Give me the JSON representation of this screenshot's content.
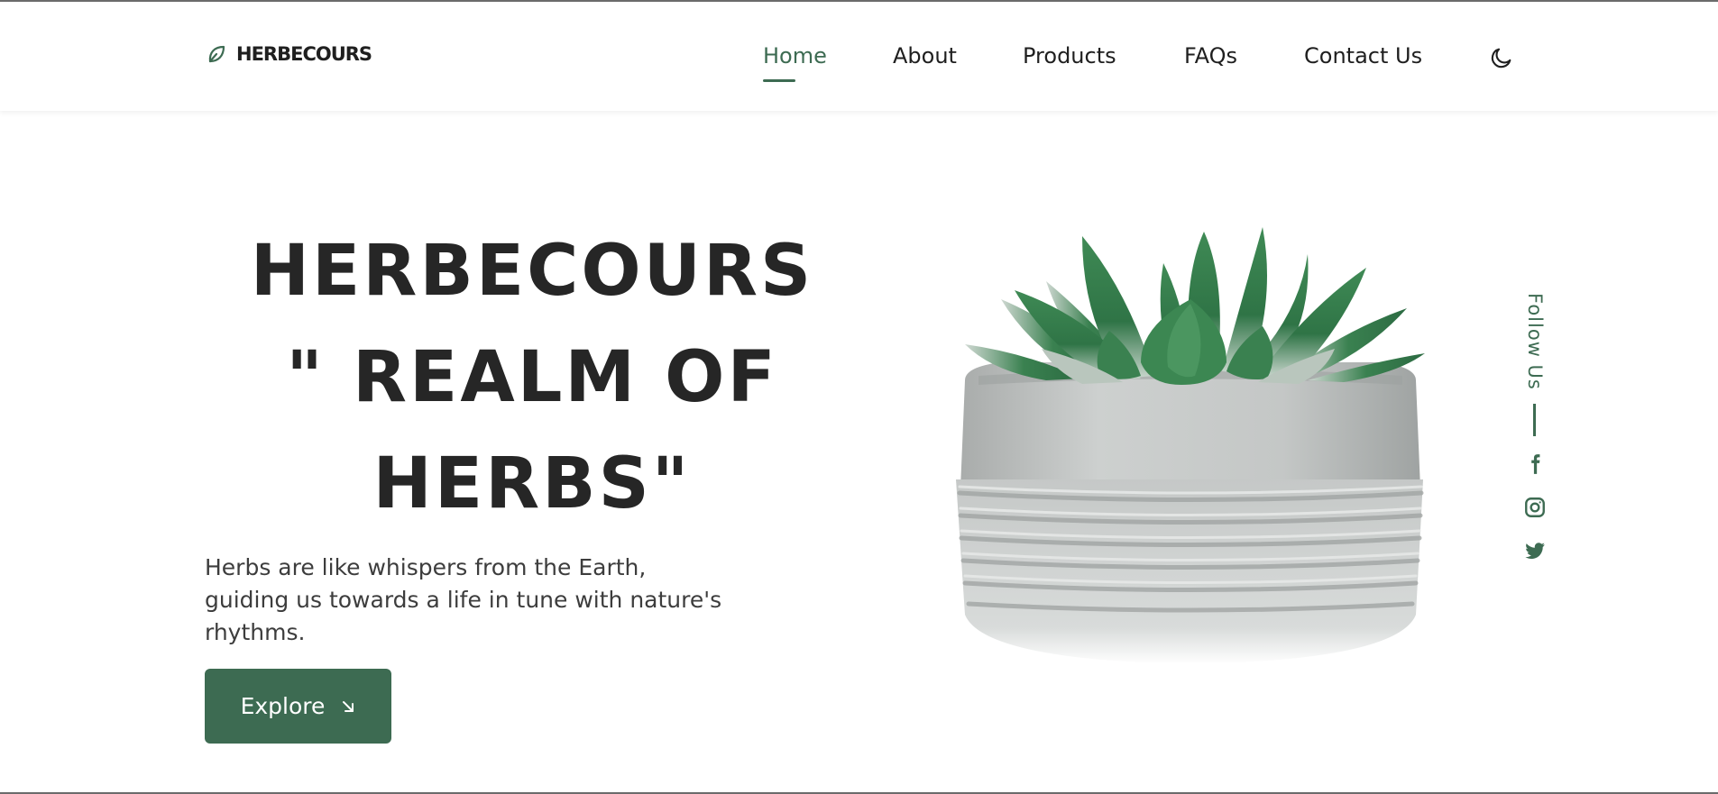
{
  "brand": {
    "name": "HERBECOURS",
    "icon": "leaf-icon"
  },
  "nav": {
    "items": [
      {
        "label": "Home",
        "active": true
      },
      {
        "label": "About",
        "active": false
      },
      {
        "label": "Products",
        "active": false
      },
      {
        "label": "FAQs",
        "active": false
      },
      {
        "label": "Contact Us",
        "active": false
      }
    ],
    "theme_toggle_icon": "moon-icon"
  },
  "hero": {
    "title_line1": "HERBECOURS",
    "title_line2": "\" REALM OF",
    "title_line3": "HERBS\"",
    "description": "Herbs are like whispers from the Earth, guiding us towards a life in tune with nature's rhythms.",
    "cta_label": "Explore",
    "cta_icon": "arrow-down-right-icon"
  },
  "social": {
    "label": "Follow Us",
    "icons": [
      "facebook-icon",
      "instagram-icon",
      "twitter-icon"
    ]
  },
  "colors": {
    "accent": "#3d6b52",
    "text": "#262626",
    "background": "#ffffff"
  }
}
